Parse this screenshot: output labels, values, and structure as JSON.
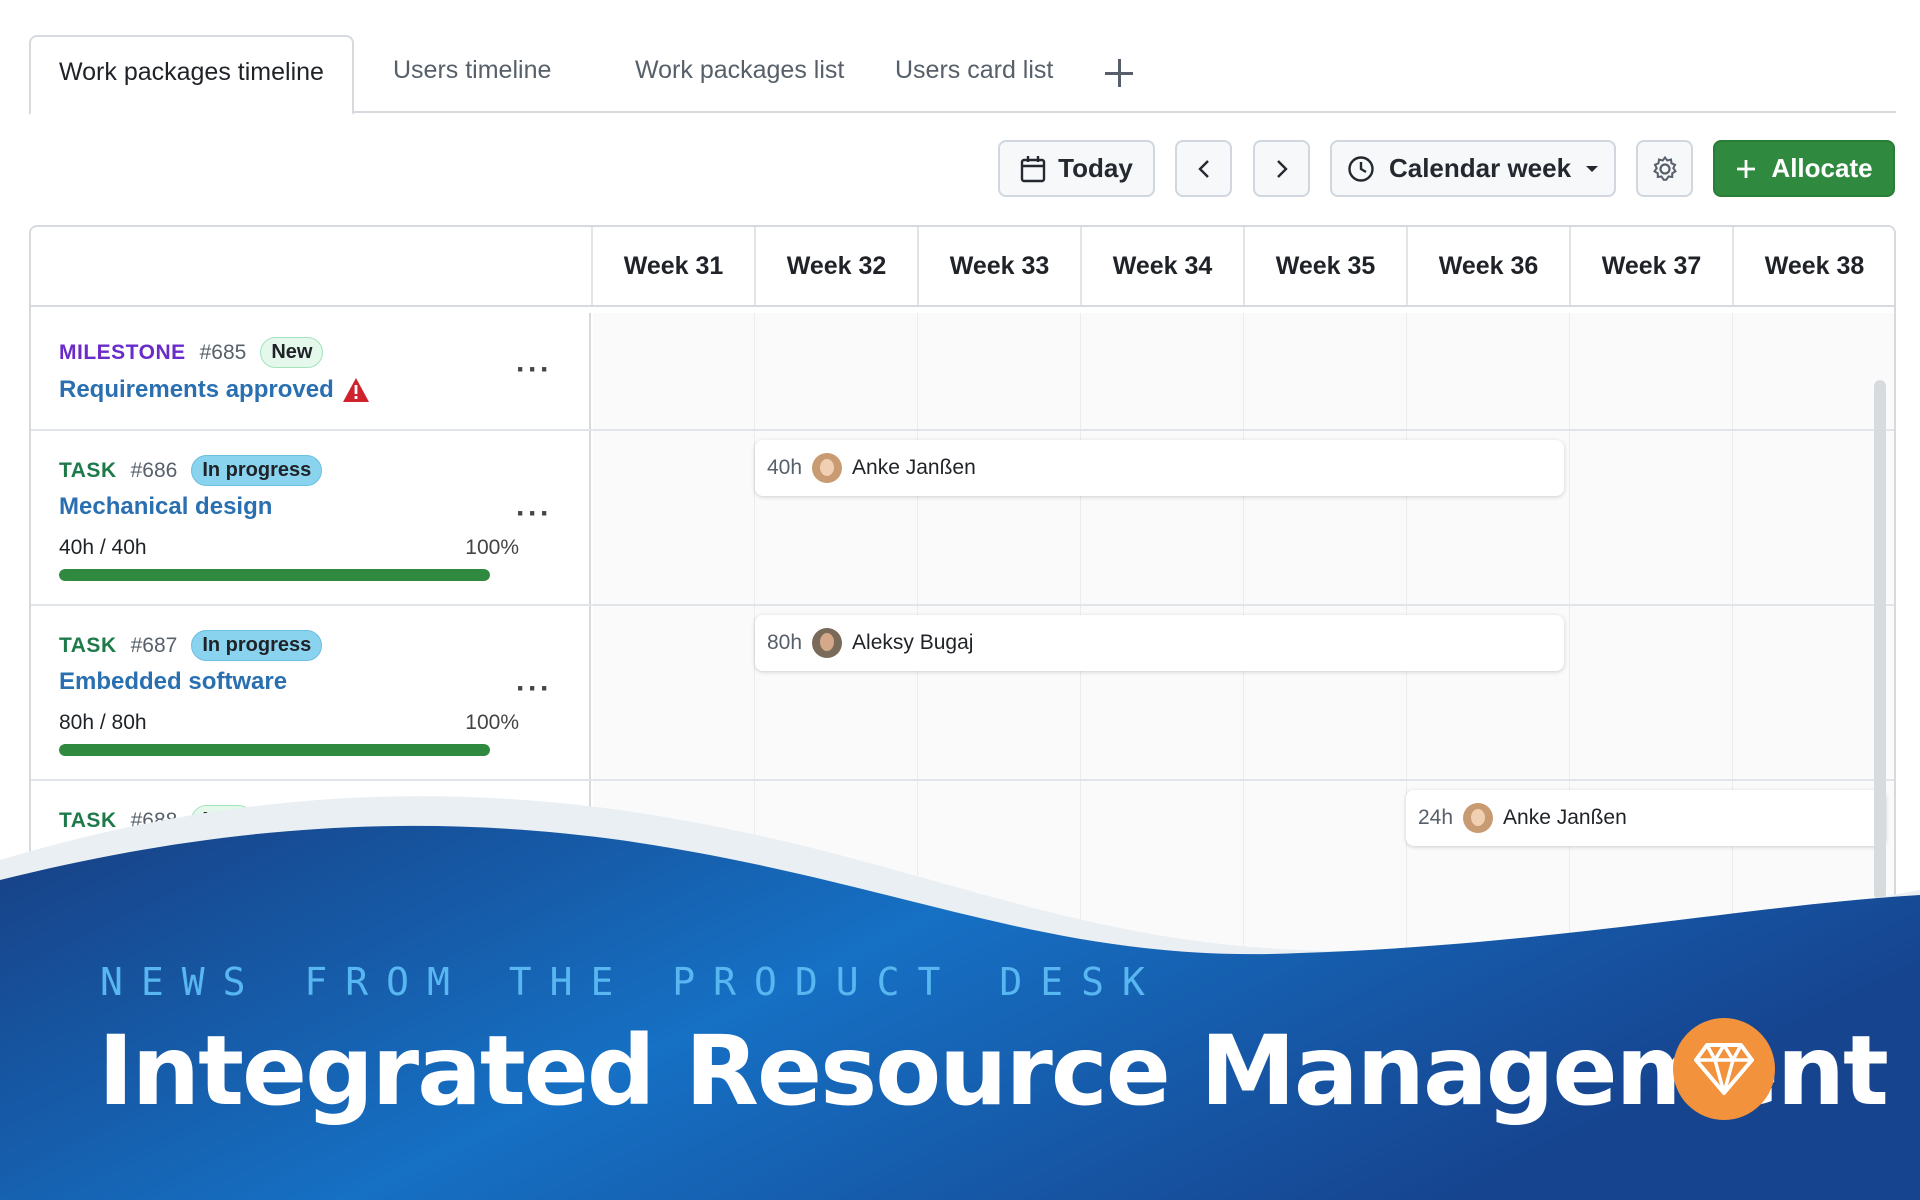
{
  "tabs": {
    "items": [
      "Work packages timeline",
      "Users timeline",
      "Work packages list",
      "Users card list"
    ],
    "active": 0
  },
  "toolbar": {
    "today": "Today",
    "view": "Calendar week",
    "allocate": "Allocate"
  },
  "weeks": [
    "Week 31",
    "Week 32",
    "Week 33",
    "Week 34",
    "Week 35",
    "Week 36",
    "Week 37",
    "Week 38"
  ],
  "rows": [
    {
      "type": "MILESTONE",
      "number": "#685",
      "status": "New",
      "title": "Requirements approved"
    },
    {
      "type": "TASK",
      "number": "#686",
      "status": "In progress",
      "title": "Mechanical design",
      "hours": "40h / 40h",
      "percent": "100%",
      "progress": 1.0
    },
    {
      "type": "TASK",
      "number": "#687",
      "status": "In progress",
      "title": "Embedded software",
      "hours": "80h / 80h",
      "percent": "100%",
      "progress": 1.0
    },
    {
      "type": "TASK",
      "number": "#688",
      "status": "New"
    }
  ],
  "allocations": [
    {
      "hours": "40h",
      "name": "Anke Janßen"
    },
    {
      "hours": "80h",
      "name": "Aleksy Bugaj"
    },
    {
      "hours": "24h",
      "name": "Anke Janßen"
    }
  ],
  "banner": {
    "kicker": "NEWS FROM THE PRODUCT DESK",
    "headline": "Integrated Resource Management",
    "colors": {
      "dark": "#173f83",
      "mid": "#1670c4",
      "accent": "#f3923c"
    }
  }
}
